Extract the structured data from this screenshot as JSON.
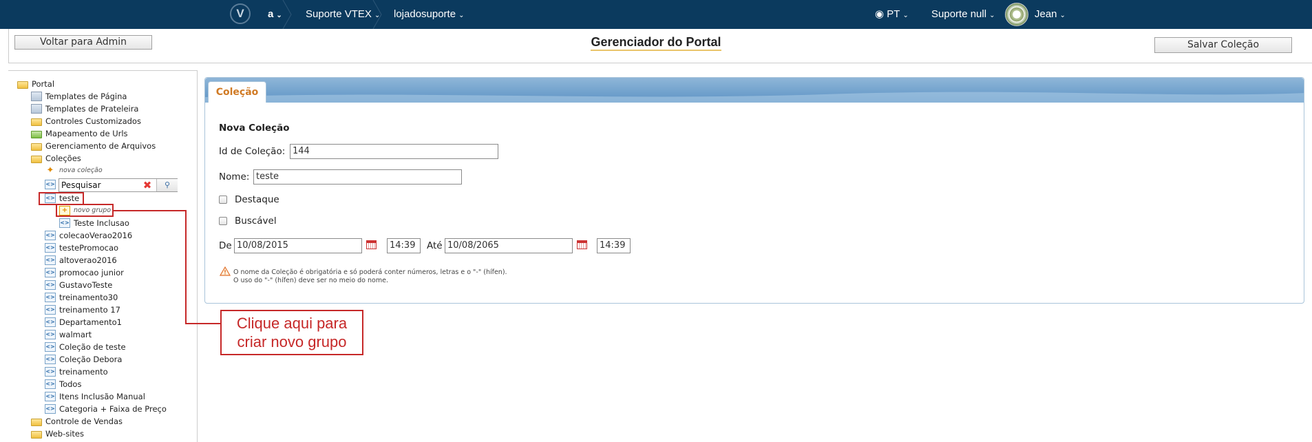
{
  "topbar": {
    "logo": "V",
    "account": "a",
    "store": "Suporte VTEX",
    "workspace": "lojadosuporte",
    "language": "PT",
    "support": "Suporte null",
    "user": "Jean"
  },
  "header": {
    "back_button": "Voltar para Admin",
    "title": "Gerenciador do Portal",
    "save_button": "Salvar Coleção"
  },
  "sidebar": {
    "root": "Portal",
    "items": [
      "Templates de Página",
      "Templates de Prateleira",
      "Controles Customizados",
      "Mapeamento de Urls",
      "Gerenciamento de Arquivos",
      "Coleções"
    ],
    "new_collection": "nova coleção",
    "search_value": "Pesquisar",
    "selected_collection": "teste",
    "new_group": "novo grupo",
    "group_item": "Teste Inclusao",
    "collections": [
      "colecaoVerao2016",
      "testePromocao",
      "altoverao2016",
      "promocao junior",
      "GustavoTeste",
      "treinamento30",
      "treinamento 17",
      "Departamento1",
      "walmart",
      "Coleção de teste",
      "Coleção Debora",
      "treinamento",
      "Todos",
      "Itens Inclusão Manual",
      "Categoria + Faixa de Preço"
    ],
    "bottom_items": [
      "Controle de Vendas",
      "Web-sites"
    ]
  },
  "callout": {
    "line1": "Clique aqui para",
    "line2": "criar novo grupo"
  },
  "panel": {
    "tab": "Coleção",
    "heading": "Nova Coleção",
    "id_label": "Id de Coleção:",
    "id_value": "144",
    "name_label": "Nome:",
    "name_value": "teste",
    "highlight_label": "Destaque",
    "searchable_label": "Buscável",
    "from_label": "De",
    "from_date": "10/08/2015",
    "from_time": "14:39",
    "to_label": "Até",
    "to_date": "10/08/2065",
    "to_time": "14:39",
    "note_line1": "O nome da Coleção é obrigatória e só poderá conter números, letras e o \"-\" (hífen).",
    "note_line2": "O uso do \"-\" (hífen) deve ser no meio do nome."
  },
  "colors": {
    "topbar": "#0b3a5e",
    "tab_text": "#d07a24",
    "annotation": "#c62828"
  }
}
